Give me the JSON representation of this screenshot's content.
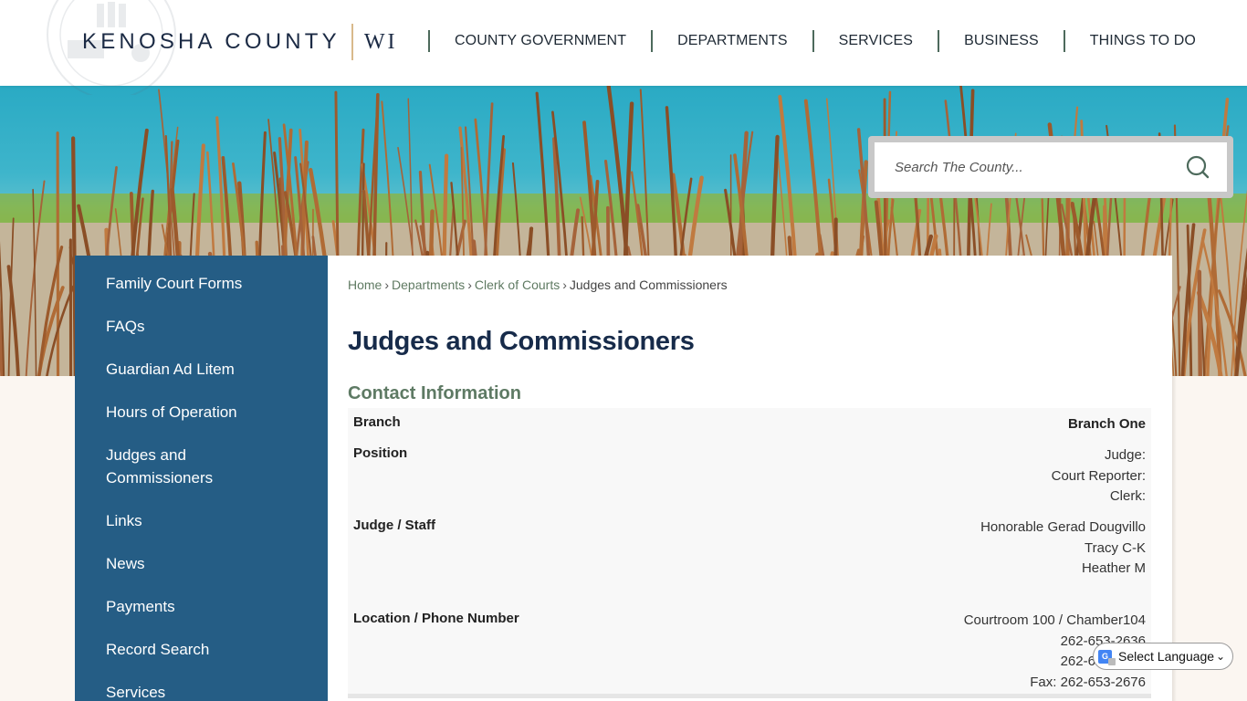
{
  "header": {
    "logo_name": "KENOSHA COUNTY",
    "logo_state": "WI",
    "nav": [
      {
        "label": "COUNTY GOVERNMENT"
      },
      {
        "label": "DEPARTMENTS"
      },
      {
        "label": "SERVICES"
      },
      {
        "label": "BUSINESS"
      },
      {
        "label": "THINGS TO DO"
      }
    ]
  },
  "search": {
    "placeholder": "Search The County...",
    "icon": "search-icon"
  },
  "sidebar": {
    "items": [
      {
        "label": "Family Court Forms"
      },
      {
        "label": "FAQs"
      },
      {
        "label": "Guardian Ad Litem"
      },
      {
        "label": "Hours of Operation"
      },
      {
        "label": "Judges and Commissioners"
      },
      {
        "label": "Links"
      },
      {
        "label": "News"
      },
      {
        "label": "Payments"
      },
      {
        "label": "Record Search"
      },
      {
        "label": "Services"
      }
    ]
  },
  "breadcrumb": {
    "items": [
      {
        "label": "Home"
      },
      {
        "label": "Departments"
      },
      {
        "label": "Clerk of Courts"
      }
    ],
    "current": "Judges and Commissioners",
    "separator": "›"
  },
  "main": {
    "title": "Judges and Commissioners",
    "section_title": "Contact Information",
    "rows": [
      {
        "label": "Branch",
        "values": [
          "Branch One"
        ]
      },
      {
        "label": "Position",
        "values": [
          "Judge:",
          "Court Reporter:",
          "Clerk:"
        ]
      },
      {
        "label": "Judge / Staff",
        "values": [
          "Honorable Gerad Dougvillo",
          "Tracy C-K",
          "Heather M"
        ]
      },
      {
        "label": "Location / Phone Number",
        "values": [
          "Courtroom 100 / Chamber104",
          "262-653-2636",
          "262-653-2637",
          "Fax: 262-653-2676"
        ]
      }
    ]
  },
  "language": {
    "label": "Select Language",
    "icon": "google-translate-icon"
  },
  "colors": {
    "sidebar": "#255d85",
    "title": "#172b4a",
    "section": "#5e7a64",
    "nav_separator": "#4d6a5c",
    "logo_accent": "#d9b98b"
  }
}
